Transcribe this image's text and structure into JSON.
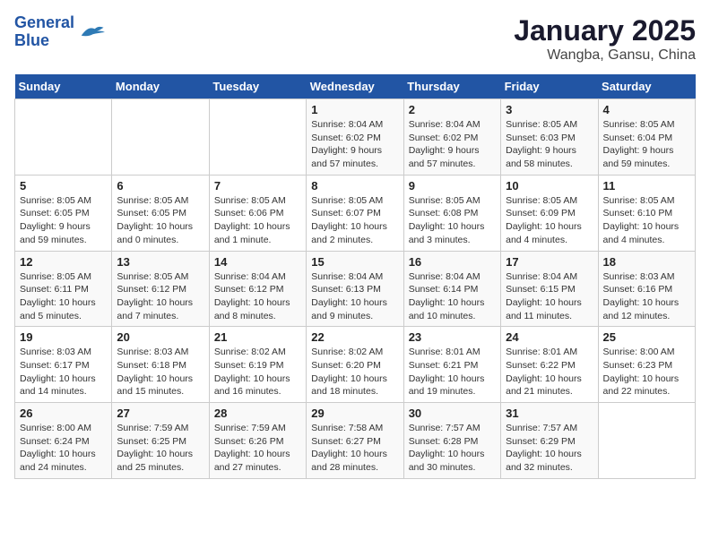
{
  "logo": {
    "line1": "General",
    "line2": "Blue"
  },
  "title": "January 2025",
  "subtitle": "Wangba, Gansu, China",
  "weekdays": [
    "Sunday",
    "Monday",
    "Tuesday",
    "Wednesday",
    "Thursday",
    "Friday",
    "Saturday"
  ],
  "weeks": [
    [
      {
        "day": "",
        "info": ""
      },
      {
        "day": "",
        "info": ""
      },
      {
        "day": "",
        "info": ""
      },
      {
        "day": "1",
        "info": "Sunrise: 8:04 AM\nSunset: 6:02 PM\nDaylight: 9 hours\nand 57 minutes."
      },
      {
        "day": "2",
        "info": "Sunrise: 8:04 AM\nSunset: 6:02 PM\nDaylight: 9 hours\nand 57 minutes."
      },
      {
        "day": "3",
        "info": "Sunrise: 8:05 AM\nSunset: 6:03 PM\nDaylight: 9 hours\nand 58 minutes."
      },
      {
        "day": "4",
        "info": "Sunrise: 8:05 AM\nSunset: 6:04 PM\nDaylight: 9 hours\nand 59 minutes."
      }
    ],
    [
      {
        "day": "5",
        "info": "Sunrise: 8:05 AM\nSunset: 6:05 PM\nDaylight: 9 hours\nand 59 minutes."
      },
      {
        "day": "6",
        "info": "Sunrise: 8:05 AM\nSunset: 6:05 PM\nDaylight: 10 hours\nand 0 minutes."
      },
      {
        "day": "7",
        "info": "Sunrise: 8:05 AM\nSunset: 6:06 PM\nDaylight: 10 hours\nand 1 minute."
      },
      {
        "day": "8",
        "info": "Sunrise: 8:05 AM\nSunset: 6:07 PM\nDaylight: 10 hours\nand 2 minutes."
      },
      {
        "day": "9",
        "info": "Sunrise: 8:05 AM\nSunset: 6:08 PM\nDaylight: 10 hours\nand 3 minutes."
      },
      {
        "day": "10",
        "info": "Sunrise: 8:05 AM\nSunset: 6:09 PM\nDaylight: 10 hours\nand 4 minutes."
      },
      {
        "day": "11",
        "info": "Sunrise: 8:05 AM\nSunset: 6:10 PM\nDaylight: 10 hours\nand 4 minutes."
      }
    ],
    [
      {
        "day": "12",
        "info": "Sunrise: 8:05 AM\nSunset: 6:11 PM\nDaylight: 10 hours\nand 5 minutes."
      },
      {
        "day": "13",
        "info": "Sunrise: 8:05 AM\nSunset: 6:12 PM\nDaylight: 10 hours\nand 7 minutes."
      },
      {
        "day": "14",
        "info": "Sunrise: 8:04 AM\nSunset: 6:12 PM\nDaylight: 10 hours\nand 8 minutes."
      },
      {
        "day": "15",
        "info": "Sunrise: 8:04 AM\nSunset: 6:13 PM\nDaylight: 10 hours\nand 9 minutes."
      },
      {
        "day": "16",
        "info": "Sunrise: 8:04 AM\nSunset: 6:14 PM\nDaylight: 10 hours\nand 10 minutes."
      },
      {
        "day": "17",
        "info": "Sunrise: 8:04 AM\nSunset: 6:15 PM\nDaylight: 10 hours\nand 11 minutes."
      },
      {
        "day": "18",
        "info": "Sunrise: 8:03 AM\nSunset: 6:16 PM\nDaylight: 10 hours\nand 12 minutes."
      }
    ],
    [
      {
        "day": "19",
        "info": "Sunrise: 8:03 AM\nSunset: 6:17 PM\nDaylight: 10 hours\nand 14 minutes."
      },
      {
        "day": "20",
        "info": "Sunrise: 8:03 AM\nSunset: 6:18 PM\nDaylight: 10 hours\nand 15 minutes."
      },
      {
        "day": "21",
        "info": "Sunrise: 8:02 AM\nSunset: 6:19 PM\nDaylight: 10 hours\nand 16 minutes."
      },
      {
        "day": "22",
        "info": "Sunrise: 8:02 AM\nSunset: 6:20 PM\nDaylight: 10 hours\nand 18 minutes."
      },
      {
        "day": "23",
        "info": "Sunrise: 8:01 AM\nSunset: 6:21 PM\nDaylight: 10 hours\nand 19 minutes."
      },
      {
        "day": "24",
        "info": "Sunrise: 8:01 AM\nSunset: 6:22 PM\nDaylight: 10 hours\nand 21 minutes."
      },
      {
        "day": "25",
        "info": "Sunrise: 8:00 AM\nSunset: 6:23 PM\nDaylight: 10 hours\nand 22 minutes."
      }
    ],
    [
      {
        "day": "26",
        "info": "Sunrise: 8:00 AM\nSunset: 6:24 PM\nDaylight: 10 hours\nand 24 minutes."
      },
      {
        "day": "27",
        "info": "Sunrise: 7:59 AM\nSunset: 6:25 PM\nDaylight: 10 hours\nand 25 minutes."
      },
      {
        "day": "28",
        "info": "Sunrise: 7:59 AM\nSunset: 6:26 PM\nDaylight: 10 hours\nand 27 minutes."
      },
      {
        "day": "29",
        "info": "Sunrise: 7:58 AM\nSunset: 6:27 PM\nDaylight: 10 hours\nand 28 minutes."
      },
      {
        "day": "30",
        "info": "Sunrise: 7:57 AM\nSunset: 6:28 PM\nDaylight: 10 hours\nand 30 minutes."
      },
      {
        "day": "31",
        "info": "Sunrise: 7:57 AM\nSunset: 6:29 PM\nDaylight: 10 hours\nand 32 minutes."
      },
      {
        "day": "",
        "info": ""
      }
    ]
  ]
}
